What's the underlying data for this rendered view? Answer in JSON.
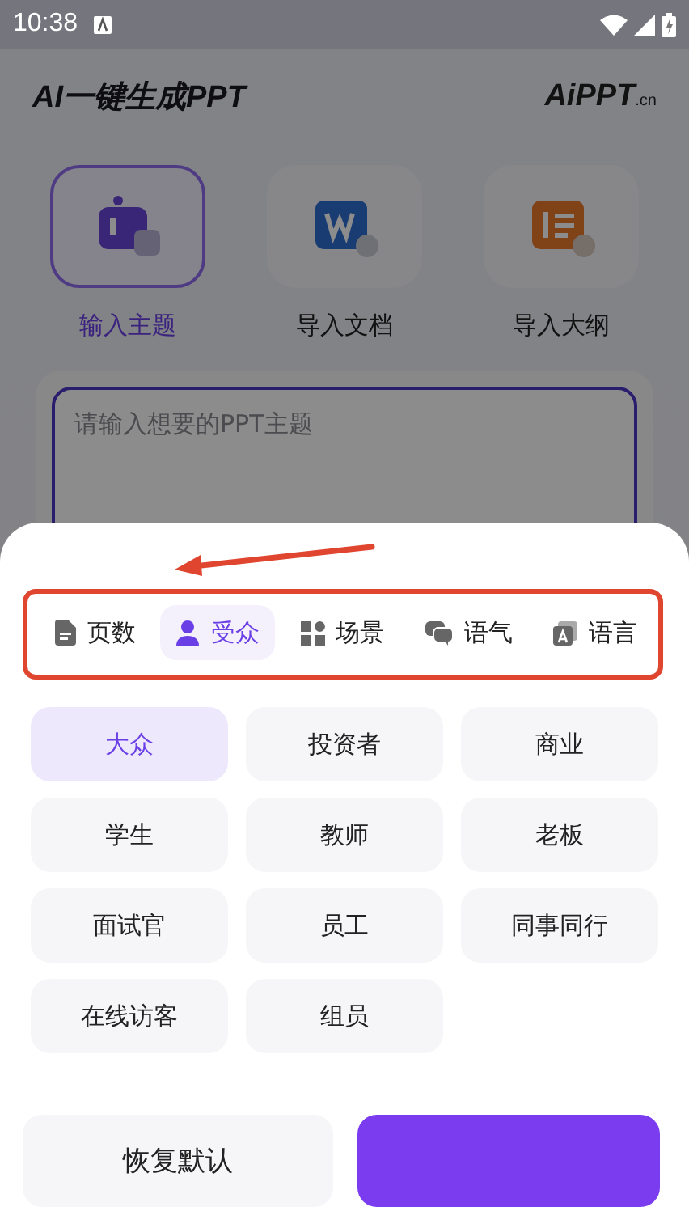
{
  "status_bar": {
    "time": "10:38"
  },
  "header": {
    "title": "AI一键生成PPT",
    "logo": "AiPPT",
    "logo_suffix": ".cn"
  },
  "modes": [
    {
      "label": "输入主题",
      "selected": true,
      "kind": "robot"
    },
    {
      "label": "导入文档",
      "selected": false,
      "kind": "word"
    },
    {
      "label": "导入大纲",
      "selected": false,
      "kind": "outline"
    }
  ],
  "topic_input": {
    "placeholder": "请输入想要的PPT主题"
  },
  "sheet": {
    "tabs": [
      {
        "label": "页数",
        "selected": false,
        "kind": "page"
      },
      {
        "label": "受众",
        "selected": true,
        "kind": "person"
      },
      {
        "label": "场景",
        "selected": false,
        "kind": "grid"
      },
      {
        "label": "语气",
        "selected": false,
        "kind": "chat"
      },
      {
        "label": "语言",
        "selected": false,
        "kind": "lang"
      }
    ],
    "options": [
      {
        "label": "大众",
        "selected": true
      },
      {
        "label": "投资者",
        "selected": false
      },
      {
        "label": "商业",
        "selected": false
      },
      {
        "label": "学生",
        "selected": false
      },
      {
        "label": "教师",
        "selected": false
      },
      {
        "label": "老板",
        "selected": false
      },
      {
        "label": "面试官",
        "selected": false
      },
      {
        "label": "员工",
        "selected": false
      },
      {
        "label": "同事同行",
        "selected": false
      },
      {
        "label": "在线访客",
        "selected": false
      },
      {
        "label": "组员",
        "selected": false
      }
    ],
    "reset_button": {
      "label": "恢复默认"
    },
    "confirm_button": {
      "kind": "primary"
    }
  }
}
